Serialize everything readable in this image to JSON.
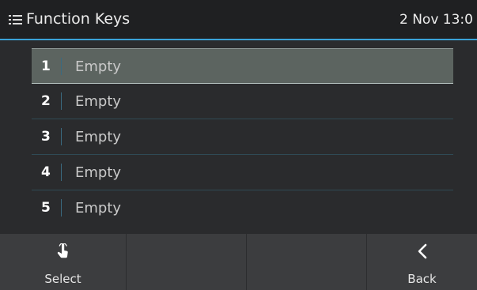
{
  "header": {
    "menu_icon": "list-menu-icon",
    "title": "Function Keys",
    "clock": "2 Nov 13:0"
  },
  "list": {
    "items": [
      {
        "number": "1",
        "label": "Empty",
        "selected": true
      },
      {
        "number": "2",
        "label": "Empty",
        "selected": false
      },
      {
        "number": "3",
        "label": "Empty",
        "selected": false
      },
      {
        "number": "4",
        "label": "Empty",
        "selected": false
      },
      {
        "number": "5",
        "label": "Empty",
        "selected": false
      }
    ]
  },
  "softkeys": {
    "select": {
      "label": "Select",
      "icon": "tap-hand-icon"
    },
    "empty2": {
      "label": ""
    },
    "empty3": {
      "label": ""
    },
    "back": {
      "label": "Back",
      "icon": "chevron-left-icon"
    }
  },
  "colors": {
    "accent": "#3aa2d8",
    "selected_row": "#5c6460",
    "softkey_bar": "#3c3d3f"
  }
}
